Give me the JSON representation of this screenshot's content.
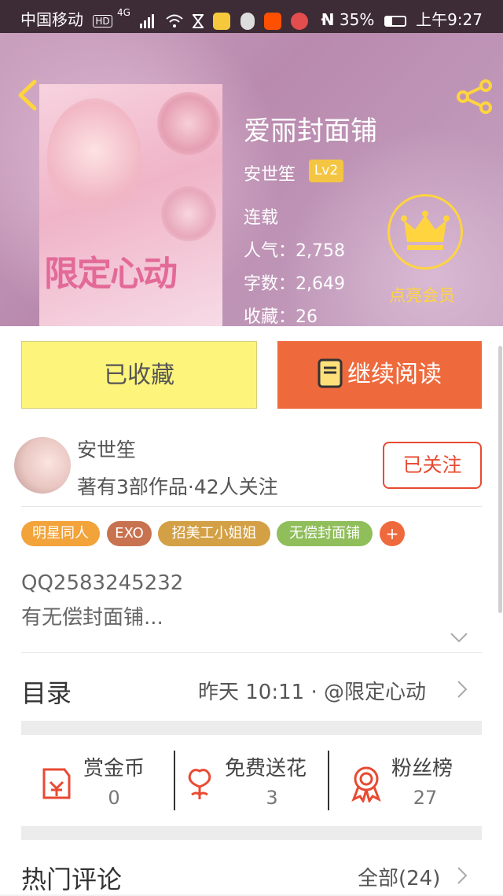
{
  "status_bar": {
    "carrier": "中国移动",
    "network": "4G",
    "battery": "35%",
    "time": "上午9:27",
    "more": "···"
  },
  "book": {
    "title": "爱丽封面铺",
    "author": "安世笙",
    "level": "Lv2",
    "status": "连载",
    "popularity_label": "人气：",
    "popularity": "2,758",
    "words_label": "字数：",
    "words": "2,649",
    "favorites_label": "收藏：",
    "favorites": "26",
    "vip_label": "点亮会员",
    "cover_title": "限定心动"
  },
  "actions": {
    "favorited": "已收藏",
    "continue": "继续阅读"
  },
  "author_card": {
    "name": "安世笙",
    "info": "著有3部作品·42人关注",
    "follow": "已关注"
  },
  "tags": [
    {
      "label": "明星同人",
      "color": "#f2a33a"
    },
    {
      "label": "EXO",
      "color": "#c8724f"
    },
    {
      "label": "招美工小姐姐",
      "color": "#d3a045"
    },
    {
      "label": "无偿封面铺",
      "color": "#8fbe5a"
    },
    {
      "label": "+",
      "color": "#ee6a3d"
    }
  ],
  "description": {
    "line1": "QQ2583245232",
    "line2": "有无偿封面铺..."
  },
  "toc": {
    "label": "目录",
    "meta": "昨天 10:11 · @限定心动"
  },
  "activities": [
    {
      "label": "赏金币",
      "value": "0",
      "icon": "red-packet-icon"
    },
    {
      "label": "免费送花",
      "value": "3",
      "icon": "flower-icon"
    },
    {
      "label": "粉丝榜",
      "value": "27",
      "icon": "medal-icon"
    }
  ],
  "comments": {
    "title": "热门评论",
    "all": "全部(24)"
  },
  "colors": {
    "accent": "#ee6a3d",
    "favorite_bg": "#fdf47b",
    "follow": "#e84a32",
    "vip": "#ffd43f"
  }
}
